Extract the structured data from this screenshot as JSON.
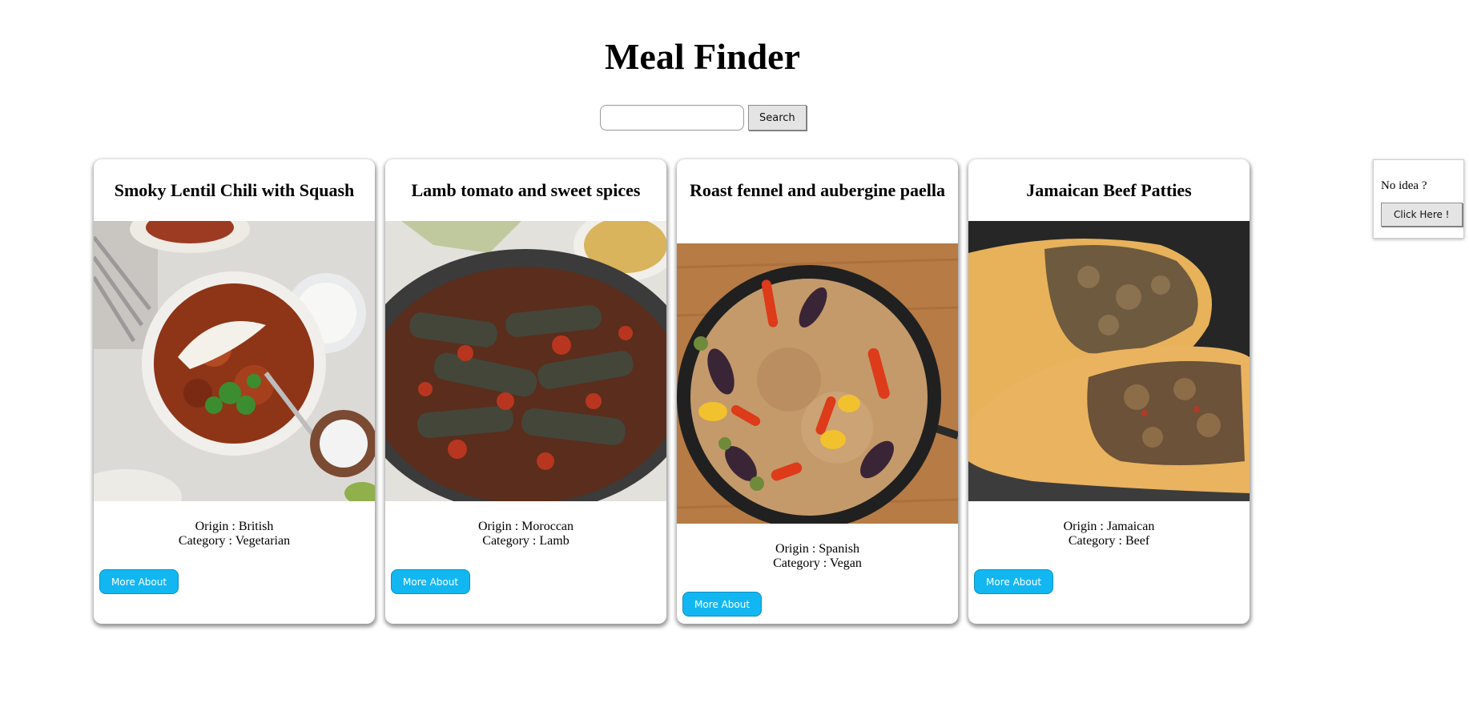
{
  "header": {
    "title": "Meal Finder"
  },
  "search": {
    "value": "",
    "placeholder": "",
    "button_label": "Search"
  },
  "meals": [
    {
      "title": "Smoky Lentil Chili with Squash",
      "origin": "Origin : British",
      "category": "Category : Vegetarian",
      "button_label": "More About",
      "image_alt": "lentil chili bowl photo"
    },
    {
      "title": "Lamb tomato and sweet spices",
      "origin": "Origin : Moroccan",
      "category": "Category : Lamb",
      "button_label": "More About",
      "image_alt": "stuffed vine leaves in tomato sauce photo"
    },
    {
      "title": "Roast fennel and aubergine paella",
      "origin": "Origin : Spanish",
      "category": "Category : Vegan",
      "button_label": "More About",
      "image_alt": "vegetable paella pan photo"
    },
    {
      "title": "Jamaican Beef Patties",
      "origin": "Origin : Jamaican",
      "category": "Category : Beef",
      "button_label": "More About",
      "image_alt": "beef patties photo"
    }
  ],
  "random": {
    "text": "No idea ?",
    "button_label": "Click Here !"
  },
  "colors": {
    "more_button": "#12b7f2",
    "gray_button": "#e4e4e4"
  }
}
